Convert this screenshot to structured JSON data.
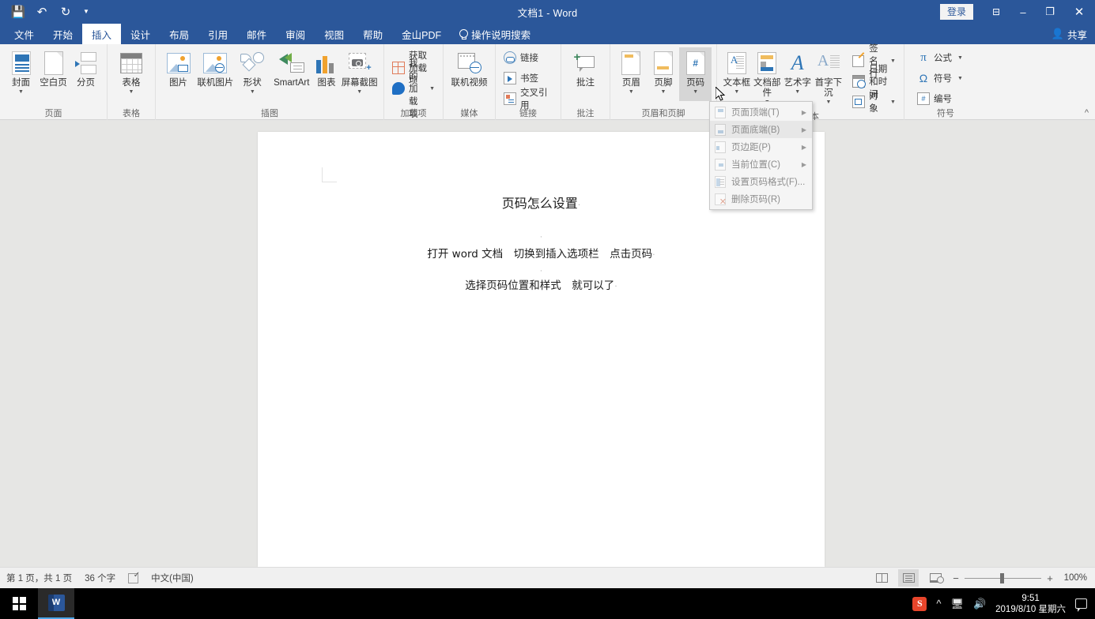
{
  "window": {
    "title": "文档1  -  Word",
    "signin_label": "登录",
    "ribbon_display_icon": "ribbon-display-options-icon",
    "minimize_icon": "minimize-icon",
    "restore_icon": "restore-icon",
    "close_icon": "close-icon"
  },
  "quick_access": {
    "save_icon": "save-icon",
    "undo_icon": "undo-icon",
    "redo_icon": "redo-icon",
    "customize_icon": "chevron-down-icon"
  },
  "tabs": [
    {
      "label": "文件",
      "active": false
    },
    {
      "label": "开始",
      "active": false
    },
    {
      "label": "插入",
      "active": true
    },
    {
      "label": "设计",
      "active": false
    },
    {
      "label": "布局",
      "active": false
    },
    {
      "label": "引用",
      "active": false
    },
    {
      "label": "邮件",
      "active": false
    },
    {
      "label": "审阅",
      "active": false
    },
    {
      "label": "视图",
      "active": false
    },
    {
      "label": "帮助",
      "active": false
    },
    {
      "label": "金山PDF",
      "active": false
    }
  ],
  "tell_me": "操作说明搜索",
  "share_label": "共享",
  "ribbon": {
    "collapse_icon": "chevron-up-icon",
    "groups": [
      {
        "label": "页面",
        "buttons": [
          {
            "name": "cover-page",
            "label": "封面",
            "caret": true
          },
          {
            "name": "blank-page",
            "label": "空白页",
            "caret": false
          },
          {
            "name": "page-break",
            "label": "分页",
            "caret": false
          }
        ]
      },
      {
        "label": "表格",
        "buttons": [
          {
            "name": "table",
            "label": "表格",
            "caret": true
          }
        ]
      },
      {
        "label": "插图",
        "buttons": [
          {
            "name": "pictures",
            "label": "图片",
            "caret": false
          },
          {
            "name": "online-pictures",
            "label": "联机图片",
            "caret": false
          },
          {
            "name": "shapes",
            "label": "形状",
            "caret": true
          },
          {
            "name": "smartart",
            "label": "SmartArt",
            "caret": false
          },
          {
            "name": "chart",
            "label": "图表",
            "caret": false
          },
          {
            "name": "screenshot",
            "label": "屏幕截图",
            "caret": true
          }
        ]
      },
      {
        "label": "加载项",
        "small_buttons": [
          {
            "name": "get-addins",
            "label": "获取加载项",
            "caret": false
          },
          {
            "name": "my-addins",
            "label": "我的加载项",
            "caret": true
          }
        ]
      },
      {
        "label": "媒体",
        "buttons": [
          {
            "name": "online-video",
            "label": "联机视频",
            "caret": false
          }
        ]
      },
      {
        "label": "链接",
        "small_buttons": [
          {
            "name": "link",
            "label": "链接",
            "caret": false
          },
          {
            "name": "bookmark",
            "label": "书签",
            "caret": false
          },
          {
            "name": "cross-reference",
            "label": "交叉引用",
            "caret": false
          }
        ]
      },
      {
        "label": "批注",
        "buttons": [
          {
            "name": "comment",
            "label": "批注",
            "caret": false
          }
        ]
      },
      {
        "label": "页眉和页脚",
        "buttons": [
          {
            "name": "header",
            "label": "页眉",
            "caret": true
          },
          {
            "name": "footer",
            "label": "页脚",
            "caret": true
          },
          {
            "name": "page-number",
            "label": "页码",
            "caret": true,
            "pressed": true
          }
        ]
      },
      {
        "label": "文本",
        "buttons": [
          {
            "name": "text-box",
            "label": "文本框",
            "caret": true
          },
          {
            "name": "quick-parts",
            "label": "文档部件",
            "caret": true
          },
          {
            "name": "word-art",
            "label": "艺术字",
            "caret": true
          },
          {
            "name": "drop-cap",
            "label": "首字下沉",
            "caret": true
          }
        ],
        "small_buttons": [
          {
            "name": "signature-line",
            "label": "签名行",
            "caret": true
          },
          {
            "name": "date-time",
            "label": "日期和时间",
            "caret": false
          },
          {
            "name": "object",
            "label": "对象",
            "caret": true
          }
        ]
      },
      {
        "label": "符号",
        "small_buttons": [
          {
            "name": "equation",
            "label": "公式",
            "caret": true
          },
          {
            "name": "symbol",
            "label": "符号",
            "caret": true
          },
          {
            "name": "numbering",
            "label": "编号",
            "caret": false
          }
        ]
      }
    ]
  },
  "page_number_menu": {
    "items": [
      {
        "label": "页面顶端(T)",
        "icon": "page-top-icon",
        "submenu": true,
        "hover": false
      },
      {
        "label": "页面底端(B)",
        "icon": "page-bottom-icon",
        "submenu": true,
        "hover": true
      },
      {
        "label": "页边距(P)",
        "icon": "page-margins-icon",
        "submenu": true,
        "hover": false
      },
      {
        "label": "当前位置(C)",
        "icon": "current-position-icon",
        "submenu": true,
        "hover": false
      },
      {
        "label": "设置页码格式(F)...",
        "icon": "format-page-numbers-icon",
        "submenu": false,
        "hover": false
      },
      {
        "label": "删除页码(R)",
        "icon": "remove-page-numbers-icon",
        "submenu": false,
        "hover": false
      }
    ]
  },
  "document": {
    "title": "页码怎么设置",
    "paragraphs": [
      "打开 word 文档　切换到插入选项栏　点击页码",
      "选择页码位置和样式　就可以了"
    ],
    "pilcrow": "·"
  },
  "status_bar": {
    "page_info": "第 1 页，共 1 页",
    "word_count": "36 个字",
    "proofing_icon": "proofing-errors-icon",
    "language": "中文(中国)",
    "views": [
      {
        "name": "read-mode",
        "icon": "read-mode-icon",
        "active": false
      },
      {
        "name": "print-layout",
        "icon": "print-layout-icon",
        "active": true
      },
      {
        "name": "web-layout",
        "icon": "web-layout-icon",
        "active": false
      }
    ],
    "zoom_out": "−",
    "zoom_in": "+",
    "zoom_value": "100%"
  },
  "taskbar": {
    "start_icon": "windows-start-icon",
    "apps": [
      {
        "name": "word-taskbar-item",
        "icon": "word-icon",
        "letter": "W"
      }
    ],
    "tray": {
      "sogou_icon": "sogou-input-icon",
      "sogou_letter": "S",
      "show_hidden_icon": "chevron-up-icon",
      "network_icon": "network-icon",
      "volume_icon": "volume-icon",
      "time": "9:51",
      "date": "2019/8/10 星期六",
      "notifications_icon": "notification-center-icon"
    }
  },
  "colors": {
    "word_blue": "#2b579a",
    "ribbon_bg": "#f3f3f3",
    "accent_blue": "#2e75b6"
  }
}
